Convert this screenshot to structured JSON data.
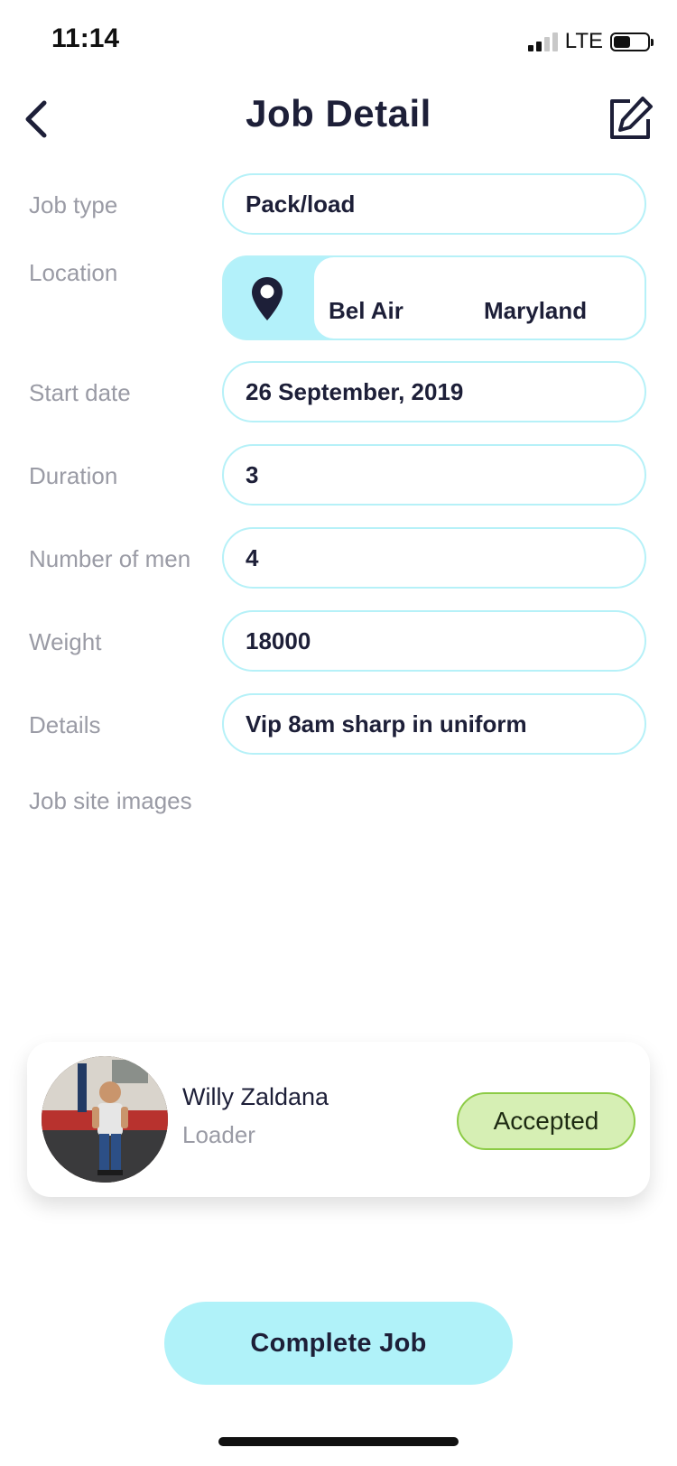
{
  "status_bar": {
    "time": "11:14",
    "network": "LTE",
    "signal_bars_on": 2,
    "signal_bars_total": 4,
    "battery_level": 0.45
  },
  "header": {
    "title": "Job Detail",
    "back_icon": "chevron-left-icon",
    "edit_icon": "edit-icon"
  },
  "fields": {
    "job_type": {
      "label": "Job type",
      "value": "Pack/load"
    },
    "location": {
      "label": "Location",
      "city": "Bel Air",
      "state": "Maryland",
      "icon": "location-pin-icon"
    },
    "start_date": {
      "label": "Start date",
      "value": "26 September, 2019"
    },
    "duration": {
      "label": "Duration",
      "value": "3"
    },
    "number_of_men": {
      "label": "Number of men",
      "value": "4"
    },
    "weight": {
      "label": "Weight",
      "value": "18000"
    },
    "details": {
      "label": "Details",
      "value": "Vip 8am sharp in uniform"
    }
  },
  "job_site_images": {
    "label": "Job site images"
  },
  "worker": {
    "name": "Willy Zaldana",
    "role": "Loader",
    "status": "Accepted"
  },
  "actions": {
    "complete_label": "Complete Job"
  },
  "colors": {
    "accent": "#b0f2f9",
    "field_border": "#b6f1f8",
    "accepted_bg": "#d6efb4",
    "accepted_border": "#8ccb45",
    "text_dark": "#1d1f38",
    "label_gray": "#9a9ba5"
  }
}
